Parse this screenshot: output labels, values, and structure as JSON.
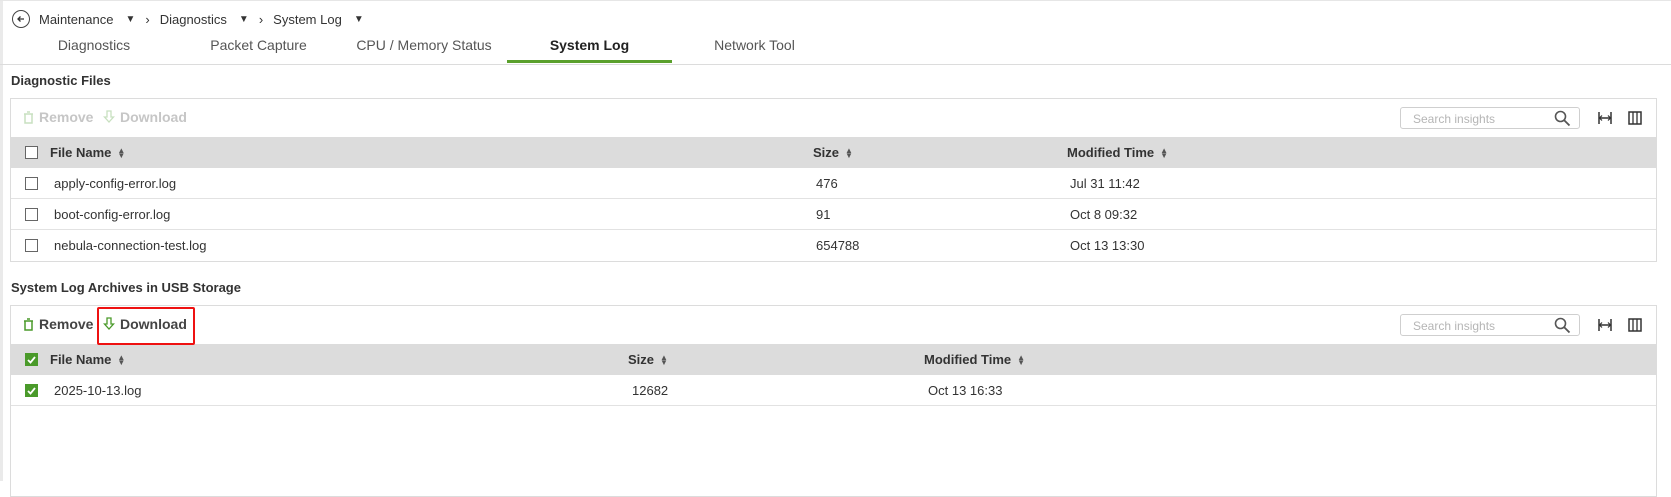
{
  "breadcrumb": {
    "items": [
      {
        "label": "Maintenance"
      },
      {
        "label": "Diagnostics"
      },
      {
        "label": "System Log"
      }
    ]
  },
  "tabs": [
    {
      "label": "Diagnostics",
      "active": false
    },
    {
      "label": "Packet Capture",
      "active": false
    },
    {
      "label": "CPU / Memory Status",
      "active": false
    },
    {
      "label": "System Log",
      "active": true
    },
    {
      "label": "Network Tool",
      "active": false
    }
  ],
  "diagnostic_files": {
    "title": "Diagnostic Files",
    "remove_label": "Remove",
    "download_label": "Download",
    "search_placeholder": "Search insights",
    "columns": [
      "File Name",
      "Size",
      "Modified Time"
    ],
    "rows": [
      {
        "name": "apply-config-error.log",
        "size": "476",
        "modified": "Jul 31 11:42",
        "checked": false
      },
      {
        "name": "boot-config-error.log",
        "size": "91",
        "modified": "Oct 8 09:32",
        "checked": false
      },
      {
        "name": "nebula-connection-test.log",
        "size": "654788",
        "modified": "Oct 13 13:30",
        "checked": false
      }
    ]
  },
  "usb_archives": {
    "title": "System Log Archives in USB Storage",
    "remove_label": "Remove",
    "download_label": "Download",
    "search_placeholder": "Search insights",
    "columns": [
      "File Name",
      "Size",
      "Modified Time"
    ],
    "rows": [
      {
        "name": "2025-10-13.log",
        "size": "12682",
        "modified": "Oct 13 16:33",
        "checked": true
      }
    ]
  },
  "colors": {
    "accent": "#5aa02c",
    "checkbox_checked": "#4a9a2a",
    "highlight": "#ee1111",
    "header_bg": "#dcdcdc"
  }
}
